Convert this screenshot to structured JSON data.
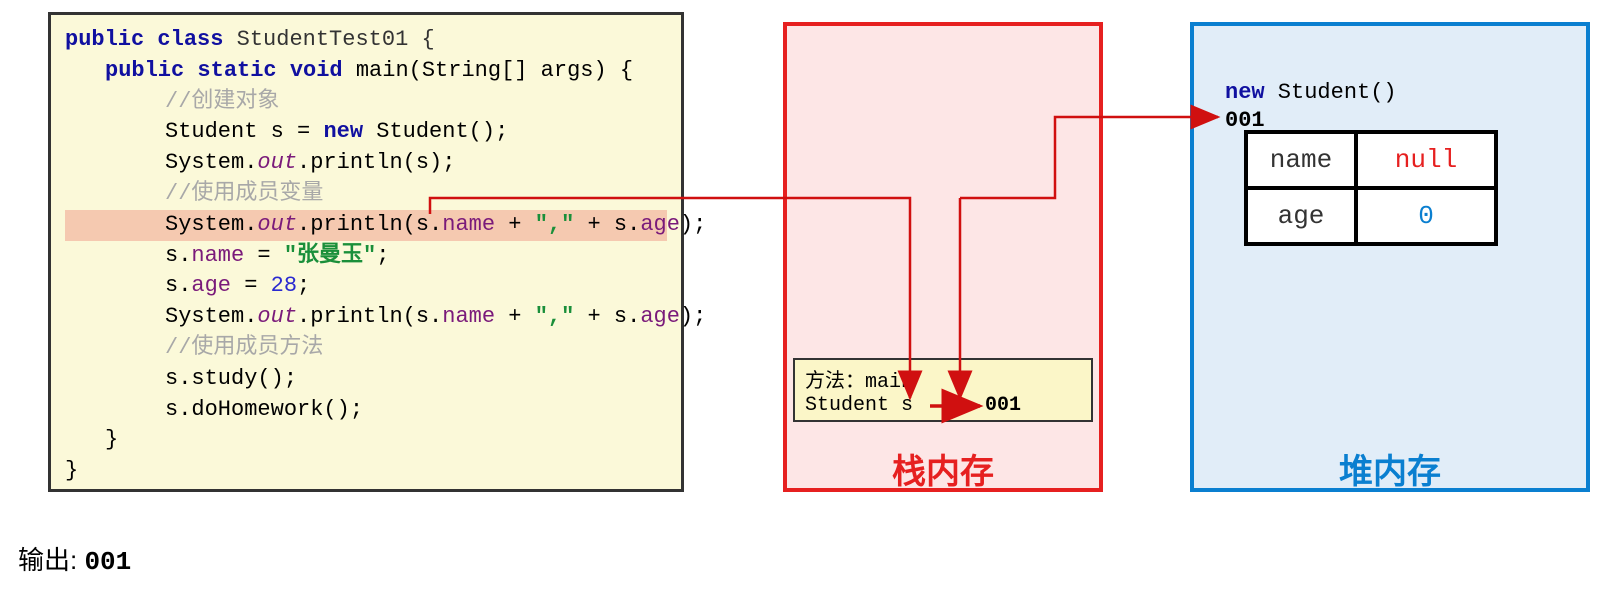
{
  "code": {
    "l1_kw1": "public class",
    "l1_cls": " StudentTest01 {",
    "l2_kw": "public static void",
    "l2_sig": " main(String[] args) {",
    "c1": "//创建对象",
    "l3a": "Student s = ",
    "l3_kw": "new",
    "l3b": " Student();",
    "l4a": "System.",
    "l4_out": "out",
    "l4b": ".println(s);",
    "c2": "//使用成员变量",
    "l5a": "System.",
    "l5_out": "out",
    "l5b": ".println(s.",
    "l5_name": "name",
    "l5c": " + ",
    "l5_str": "\",\"",
    "l5d": " + s.",
    "l5_age": "age",
    "l5e": ");",
    "l6a": "s.",
    "l6_name": "name",
    "l6b": " = ",
    "l6_str": "\"张曼玉\"",
    "l6c": ";",
    "l7a": "s.",
    "l7_age": "age",
    "l7b": " = ",
    "l7_num": "28",
    "l7c": ";",
    "l8a": "System.",
    "l8_out": "out",
    "l8b": ".println(s.",
    "l8_name": "name",
    "l8c": " + ",
    "l8_str": "\",\"",
    "l8d": " + s.",
    "l8_age": "age",
    "l8e": ");",
    "c3": "//使用成员方法",
    "l9": "s.study();",
    "l10": "s.doHomework();",
    "rb1": "}",
    "rb2": "}"
  },
  "stack": {
    "label": "栈内存",
    "frame_l1": "方法：main",
    "frame_l2a": "Student s",
    "frame_addr": "001"
  },
  "heap": {
    "label": "堆内存",
    "new_kw": "new",
    "new_txt": " Student()",
    "addr": "001",
    "fields": {
      "name_label": "name",
      "name_value": "null",
      "age_label": "age",
      "age_value": "0"
    }
  },
  "output": {
    "label": "输出: ",
    "value": "001"
  },
  "colors": {
    "stack_border": "#e62020",
    "heap_border": "#0a7fd0",
    "code_bg": "#fbf9d9"
  }
}
